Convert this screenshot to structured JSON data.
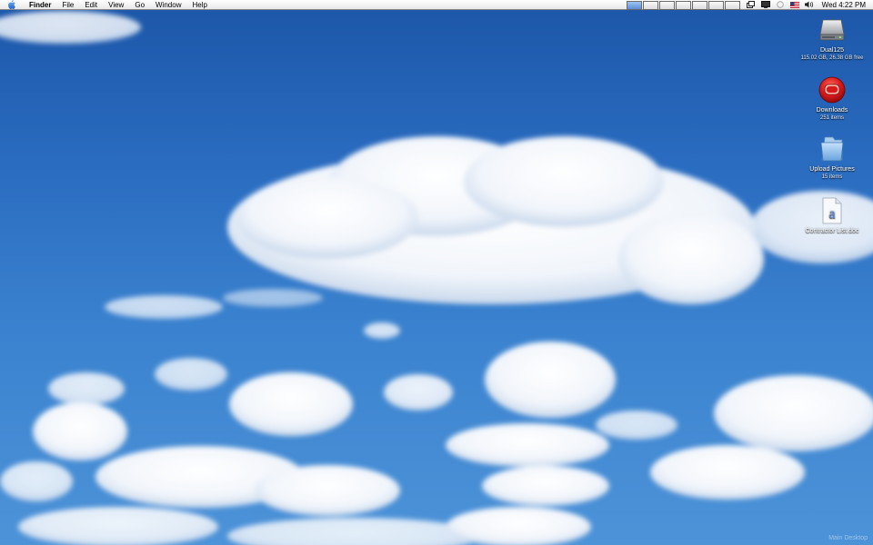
{
  "menubar": {
    "apple_icon": "apple-icon",
    "app_name": "Finder",
    "menus": [
      "File",
      "Edit",
      "View",
      "Go",
      "Window",
      "Help"
    ],
    "spaces_count": 8,
    "active_space": 1,
    "status_icons": [
      "spaces-icon",
      "display-icon",
      "sync-icon",
      "flag-icon",
      "volume-icon"
    ],
    "clock": "Wed 4:22 PM"
  },
  "desktop_icons": [
    {
      "name": "Dual125",
      "info": "115.02 GB, 26.38 GB free",
      "icon": "hard-drive-icon"
    },
    {
      "name": "Downloads",
      "info": "251 items",
      "icon": "downloads-icon"
    },
    {
      "name": "Upload Pictures",
      "info": "15 items",
      "icon": "folder-icon"
    },
    {
      "name": "Contractor List.doc",
      "info": "",
      "icon": "document-icon"
    }
  ],
  "desktop_label": "Main Desktop",
  "colors": {
    "sky_top": "#1c56a8",
    "sky_bottom": "#4d93d8",
    "downloads_red": "#d8191b",
    "folder_blue": "#7fb2e8",
    "active_space": "#5b8fd8"
  }
}
